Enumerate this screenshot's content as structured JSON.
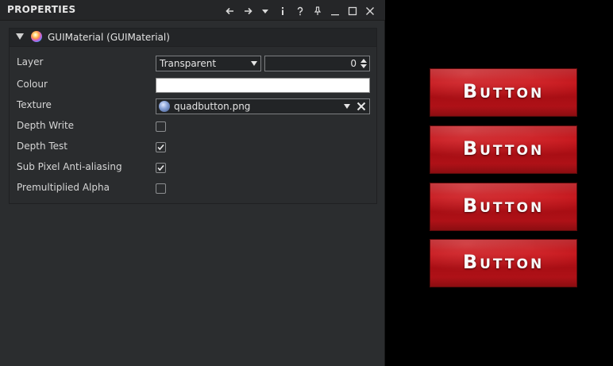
{
  "panel": {
    "title": "PROPERTIES",
    "toolbar_icons": [
      "back-arrow-icon",
      "forward-arrow-icon",
      "dropdown-menu-icon",
      "info-icon",
      "help-icon",
      "pin-icon",
      "minimize-icon",
      "maximize-icon",
      "close-icon"
    ]
  },
  "section": {
    "title": "GUIMaterial (GUIMaterial)"
  },
  "props": {
    "layer": {
      "label": "Layer",
      "value": "Transparent",
      "number": "0"
    },
    "colour": {
      "label": "Colour",
      "value_color": "#ffffff"
    },
    "texture": {
      "label": "Texture",
      "value": "quadbutton.png"
    },
    "depth_write": {
      "label": "Depth Write",
      "checked": false
    },
    "depth_test": {
      "label": "Depth Test",
      "checked": true
    },
    "sub_pixel": {
      "label": "Sub Pixel Anti-aliasing",
      "checked": true
    },
    "premultiplied": {
      "label": "Premultiplied Alpha",
      "checked": false
    }
  },
  "preview": {
    "buttons": [
      {
        "label": "Button"
      },
      {
        "label": "Button"
      },
      {
        "label": "Button"
      },
      {
        "label": "Button"
      }
    ]
  }
}
